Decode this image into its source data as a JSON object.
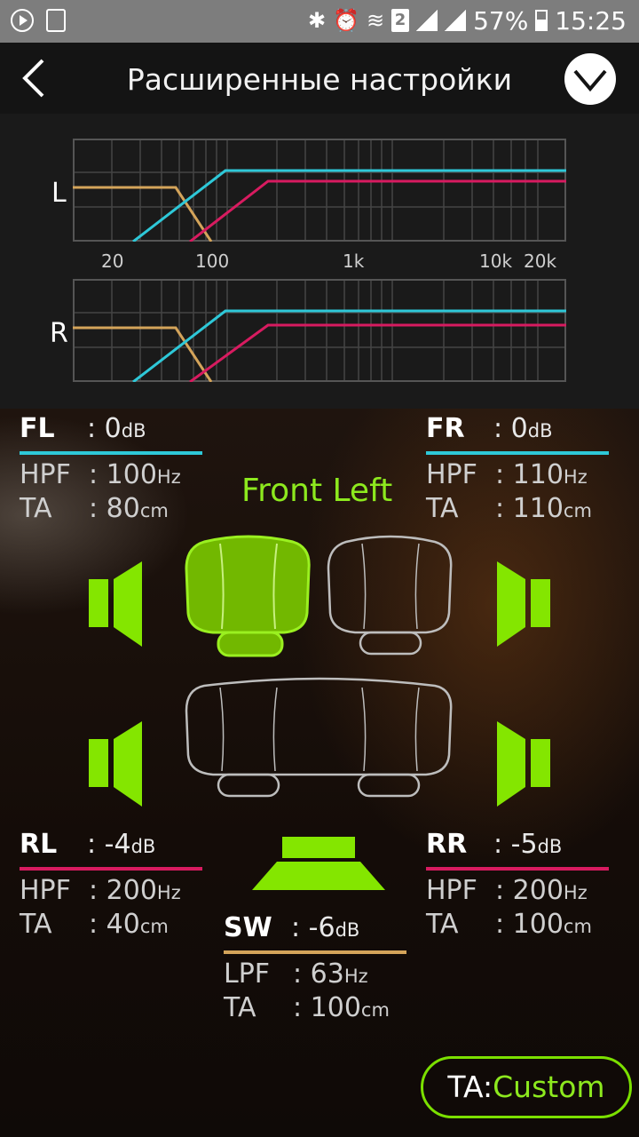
{
  "status": {
    "battery": "57%",
    "time": "15:25",
    "sim": "2"
  },
  "header": {
    "title": "Расширенные настройки"
  },
  "graphs": {
    "left_label": "L",
    "right_label": "R",
    "freq_ticks": [
      "20",
      "100",
      "1k",
      "10k",
      "20k"
    ],
    "colors": {
      "hpf_front": "#2ec8d8",
      "hpf_rear": "#d81b60",
      "lpf_sub": "#d4a45a"
    }
  },
  "selected_label": "Front Left",
  "channels": {
    "fl": {
      "name": "FL",
      "level": ": 0",
      "level_unit": "dB",
      "filter_label": "HPF",
      "filter_value": ": 100",
      "filter_unit": "Hz",
      "ta_label": "TA",
      "ta_value": ": 80",
      "ta_unit": "cm"
    },
    "fr": {
      "name": "FR",
      "level": ": 0",
      "level_unit": "dB",
      "filter_label": "HPF",
      "filter_value": ": 110",
      "filter_unit": "Hz",
      "ta_label": "TA",
      "ta_value": ": 110",
      "ta_unit": "cm"
    },
    "rl": {
      "name": "RL",
      "level": ": -4",
      "level_unit": "dB",
      "filter_label": "HPF",
      "filter_value": ": 200",
      "filter_unit": "Hz",
      "ta_label": "TA",
      "ta_value": ": 40",
      "ta_unit": "cm"
    },
    "rr": {
      "name": "RR",
      "level": ": -5",
      "level_unit": "dB",
      "filter_label": "HPF",
      "filter_value": ": 200",
      "filter_unit": "Hz",
      "ta_label": "TA",
      "ta_value": ": 100",
      "ta_unit": "cm"
    },
    "sw": {
      "name": "SW",
      "level": ": -6",
      "level_unit": "dB",
      "filter_label": "LPF",
      "filter_value": ": 63",
      "filter_unit": "Hz",
      "ta_label": "TA",
      "ta_value": ": 100",
      "ta_unit": "cm"
    }
  },
  "ta_button": {
    "prefix": "TA:",
    "value": "Custom"
  },
  "accent": "#8de91e"
}
